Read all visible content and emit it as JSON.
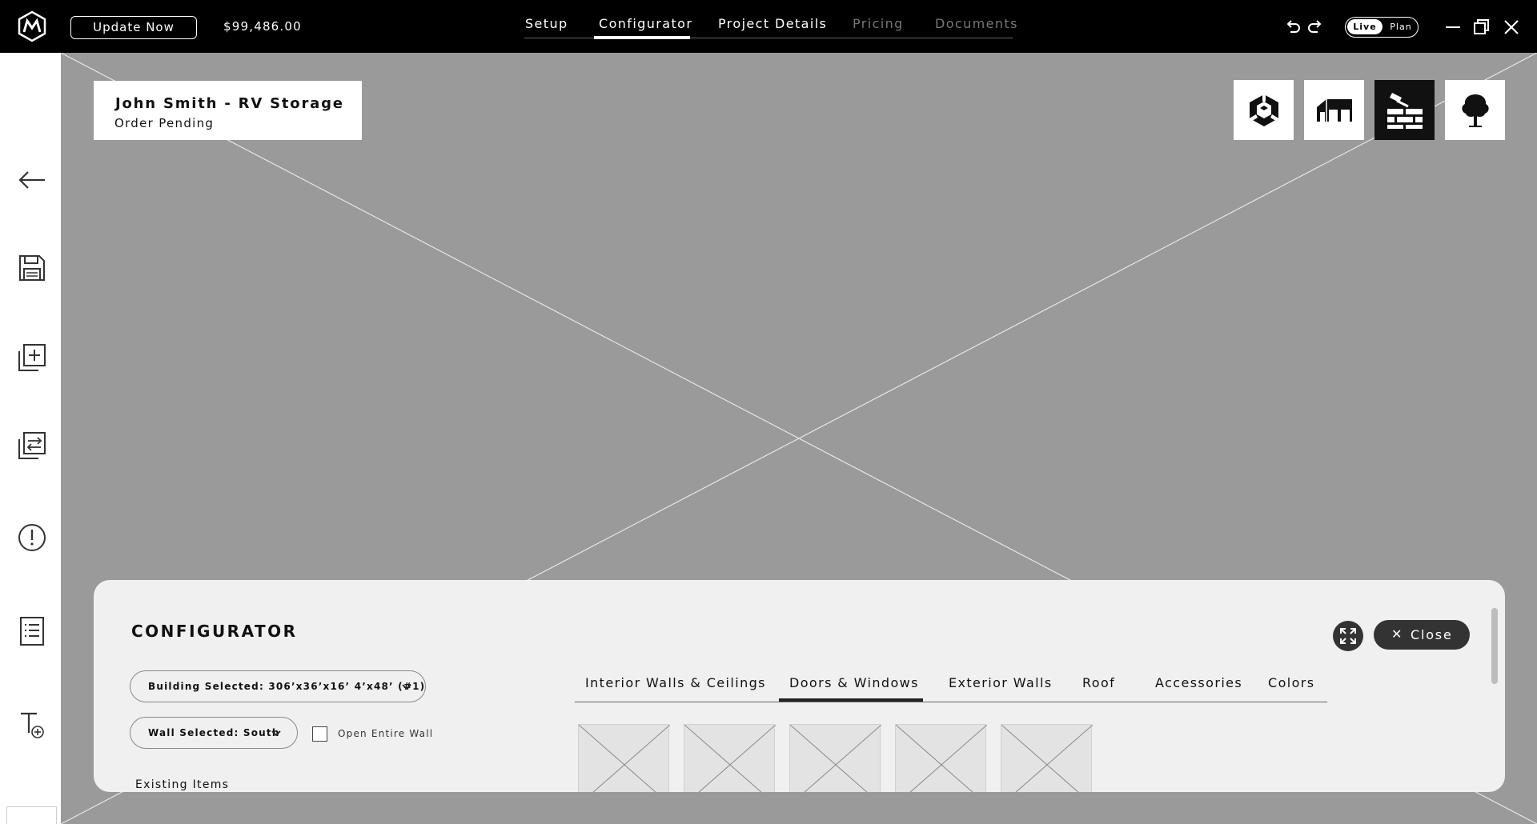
{
  "topbar": {
    "logo_icon": "m-logo-icon",
    "update_label": "Update Now",
    "price": "$99,486.00",
    "tabs": [
      {
        "label": "Setup",
        "state": "normal"
      },
      {
        "label": "Configurator",
        "state": "active"
      },
      {
        "label": "Project Details",
        "state": "normal"
      },
      {
        "label": "Pricing",
        "state": "disabled"
      },
      {
        "label": "Documents",
        "state": "disabled"
      }
    ],
    "toggle": {
      "live": "Live",
      "plan": "Plan",
      "selected": "Live"
    }
  },
  "sidebar": {
    "icons": [
      "back-arrow-icon",
      "save-icon",
      "add-building-icon",
      "swap-icon",
      "alert-icon",
      "list-icon",
      "add-text-icon"
    ]
  },
  "project": {
    "title": "John Smith - RV Storage",
    "status": "Order Pending"
  },
  "view_buttons": [
    {
      "icon": "3d-cube-icon",
      "active": false
    },
    {
      "icon": "building-icon",
      "active": false
    },
    {
      "icon": "wall-brick-icon",
      "active": true
    },
    {
      "icon": "tree-icon",
      "active": false
    }
  ],
  "configurator": {
    "title": "CONFIGURATOR",
    "close_label": "Close",
    "building_select": "Building Selected: 306’x36’x16’ 4’x48’ (#1)",
    "wall_select": "Wall Selected: South",
    "open_entire_wall_label": "Open Entire Wall",
    "open_entire_wall_checked": false,
    "existing_items_label": "Existing Items",
    "tabs": [
      {
        "label": "Interior Walls & Ceilings",
        "active": false
      },
      {
        "label": "Doors & Windows",
        "active": true
      },
      {
        "label": "Exterior Walls",
        "active": false
      },
      {
        "label": "Roof",
        "active": false
      },
      {
        "label": "Accessories",
        "active": false
      },
      {
        "label": "Colors",
        "active": false
      }
    ],
    "thumbnail_count": 5
  },
  "colors": {
    "topbar": "#000000",
    "canvas": "#9a9a9a",
    "panel": "#f0f0f0",
    "accent_dark": "#333333"
  }
}
